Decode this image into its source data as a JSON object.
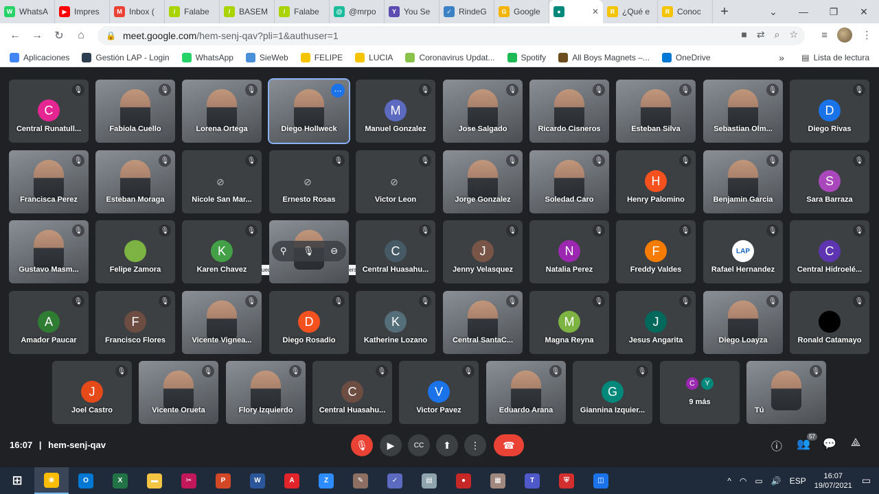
{
  "browser": {
    "tabs": [
      {
        "title": "WhatsA",
        "color": "#25d366",
        "glyph": "W"
      },
      {
        "title": "Impres",
        "color": "#ff0000",
        "glyph": "▶"
      },
      {
        "title": "Inbox (",
        "color": "#ea4335",
        "glyph": "M"
      },
      {
        "title": "Falabe",
        "color": "#aad400",
        "glyph": "/"
      },
      {
        "title": "BASEM",
        "color": "#aad400",
        "glyph": "/"
      },
      {
        "title": "Falabe",
        "color": "#aad400",
        "glyph": "/"
      },
      {
        "title": "@mrpo",
        "color": "#1abc9c",
        "glyph": "@"
      },
      {
        "title": "You Se",
        "color": "#5c4bb0",
        "glyph": "Y"
      },
      {
        "title": "RindeG",
        "color": "#3b82c4",
        "glyph": "✓"
      },
      {
        "title": "Google",
        "color": "#f4b400",
        "glyph": "G"
      },
      {
        "title": "",
        "color": "#00897b",
        "glyph": "●",
        "active": true
      },
      {
        "title": "¿Qué e",
        "color": "#f5c400",
        "glyph": "R"
      },
      {
        "title": "Conoc",
        "color": "#f5c400",
        "glyph": "R"
      }
    ],
    "url_host": "meet.google.com",
    "url_path": "/hem-senj-qav?pli=1&authuser=1",
    "bookmarks": [
      {
        "label": "Aplicaciones",
        "color": "#4285f4"
      },
      {
        "label": "Gestión LAP - Login",
        "color": "#2c3e50"
      },
      {
        "label": "WhatsApp",
        "color": "#25d366"
      },
      {
        "label": "SieWeb",
        "color": "#4a90d9"
      },
      {
        "label": "FELIPE",
        "color": "#f5c400"
      },
      {
        "label": "LUCIA",
        "color": "#f5c400"
      },
      {
        "label": "Coronavirus Updat...",
        "color": "#8bc34a"
      },
      {
        "label": "Spotify",
        "color": "#1db954"
      },
      {
        "label": "All Boys Magnets –...",
        "color": "#6d4c1f"
      },
      {
        "label": "OneDrive",
        "color": "#0078d4"
      }
    ],
    "reading_list": "Lista de lectura",
    "more_bookmarks": "»"
  },
  "meeting": {
    "time": "16:07",
    "separator": "|",
    "code": "hem-senj-qav",
    "participant_count": "57",
    "tooltip": "No puedes activar el micrófono de otra persona",
    "more_label": "9 más",
    "rows": [
      [
        {
          "name": "Central Runatull...",
          "initial": "C",
          "color": "#e52592"
        },
        {
          "name": "Fabiola Cuello",
          "cam": true
        },
        {
          "name": "Lorena Ortega",
          "cam": true
        },
        {
          "name": "Diego Hollweck",
          "cam": true,
          "active": true
        },
        {
          "name": "Manuel Gonzalez",
          "initial": "M",
          "color": "#5c6bc0"
        },
        {
          "name": "Jose Salgado",
          "cam": true
        },
        {
          "name": "Ricardo Cisneros",
          "cam": true
        },
        {
          "name": "Esteban Silva",
          "cam": true
        },
        {
          "name": "Sebastian Olm...",
          "cam": true
        },
        {
          "name": "Diego Rivas",
          "initial": "D",
          "color": "#1a73e8"
        }
      ],
      [
        {
          "name": "Francisca Perez",
          "cam": true
        },
        {
          "name": "Esteban Moraga",
          "cam": true
        },
        {
          "name": "Nicole San Mar...",
          "camoff": true
        },
        {
          "name": "Ernesto Rosas",
          "camoff": true
        },
        {
          "name": "Victor Leon",
          "camoff": true
        },
        {
          "name": "Jorge Gonzalez",
          "cam": true
        },
        {
          "name": "Soledad Caro",
          "cam": true
        },
        {
          "name": "Henry Palomino",
          "initial": "H",
          "color": "#f4511e"
        },
        {
          "name": "Benjamin Garcia",
          "cam": true
        },
        {
          "name": "Sara Barraza",
          "initial": "S",
          "color": "#ab47bc"
        }
      ],
      [
        {
          "name": "Gustavo Masm...",
          "cam": true
        },
        {
          "name": "Felipe Zamora",
          "initial": "",
          "color": "#7cb342"
        },
        {
          "name": "Karen Chavez",
          "initial": "K",
          "color": "#43a047"
        },
        {
          "name": "",
          "cam": true,
          "hover": true
        },
        {
          "name": "Central Huasahu...",
          "initial": "C",
          "color": "#455a64"
        },
        {
          "name": "Jenny Velasquez",
          "initial": "J",
          "color": "#795548"
        },
        {
          "name": "Natalia Perez",
          "initial": "N",
          "color": "#9c27b0"
        },
        {
          "name": "Freddy Valdes",
          "initial": "F",
          "color": "#f57c00"
        },
        {
          "name": "Rafael Hernandez",
          "initial": "LAP",
          "color": "#ffffff"
        },
        {
          "name": "Central Hidroelé...",
          "initial": "C",
          "color": "#5e35b1"
        }
      ],
      [
        {
          "name": "Amador Paucar",
          "initial": "A",
          "color": "#2e7d32"
        },
        {
          "name": "Francisco Flores",
          "initial": "F",
          "color": "#6d4c41"
        },
        {
          "name": "Vicente Vignea...",
          "cam": true
        },
        {
          "name": "Diego Rosadio",
          "initial": "D",
          "color": "#f4511e"
        },
        {
          "name": "Katherine Lozano",
          "initial": "K",
          "color": "#546e7a"
        },
        {
          "name": "Central SantaC...",
          "cam": true
        },
        {
          "name": "Magna Reyna",
          "initial": "M",
          "color": "#7cb342"
        },
        {
          "name": "Jesus Angarita",
          "initial": "J",
          "color": "#00695c"
        },
        {
          "name": "Diego Loayza",
          "cam": true
        },
        {
          "name": "Ronald Catamayo",
          "initial": "",
          "color": "#000000"
        }
      ],
      [
        {
          "name": "Joel Castro",
          "initial": "J",
          "color": "#e64a19"
        },
        {
          "name": "Vicente Orueta",
          "cam": true
        },
        {
          "name": "Flory Izquierdo",
          "cam": true
        },
        {
          "name": "Central Huasahu...",
          "initial": "C",
          "color": "#6d4c41"
        },
        {
          "name": "Victor Pavez",
          "initial": "V",
          "color": "#1a73e8"
        },
        {
          "name": "Eduardo Arana",
          "cam": true
        },
        {
          "name": "Giannina Izquier...",
          "initial": "G",
          "color": "#00897b"
        },
        {
          "name": "",
          "more": true
        },
        {
          "name": "Tú",
          "cam": true,
          "self": true
        }
      ]
    ],
    "more_avatars": [
      {
        "initial": "C",
        "color": "#9c27b0"
      },
      {
        "initial": "Y",
        "color": "#00897b"
      }
    ]
  },
  "taskbar": {
    "apps": [
      {
        "name": "start-button",
        "color": "#1f2a3a",
        "glyph": "⊞"
      },
      {
        "name": "chrome",
        "color": "#fbbc04",
        "glyph": "◉",
        "running": true
      },
      {
        "name": "outlook",
        "color": "#0078d4",
        "glyph": "O"
      },
      {
        "name": "excel",
        "color": "#217346",
        "glyph": "X"
      },
      {
        "name": "file-explorer",
        "color": "#f4c542",
        "glyph": "▬"
      },
      {
        "name": "snip",
        "color": "#c2185b",
        "glyph": "✂"
      },
      {
        "name": "powerpoint",
        "color": "#d24726",
        "glyph": "P"
      },
      {
        "name": "word",
        "color": "#2b579a",
        "glyph": "W"
      },
      {
        "name": "acrobat",
        "color": "#e3242b",
        "glyph": "A"
      },
      {
        "name": "zoom",
        "color": "#2d8cff",
        "glyph": "Z"
      },
      {
        "name": "paint",
        "color": "#8d6e63",
        "glyph": "✎"
      },
      {
        "name": "editor",
        "color": "#5c6bc0",
        "glyph": "✓"
      },
      {
        "name": "printer",
        "color": "#90a4ae",
        "glyph": "▤"
      },
      {
        "name": "recorder",
        "color": "#c62828",
        "glyph": "●"
      },
      {
        "name": "archive",
        "color": "#a1887f",
        "glyph": "▦"
      },
      {
        "name": "teams",
        "color": "#5059c9",
        "glyph": "T"
      },
      {
        "name": "shield",
        "color": "#d32f2f",
        "glyph": "⛨"
      },
      {
        "name": "meet-app",
        "color": "#1a73e8",
        "glyph": "◫"
      }
    ],
    "language": "ESP",
    "clock_time": "16:07",
    "clock_date": "19/07/2021"
  }
}
